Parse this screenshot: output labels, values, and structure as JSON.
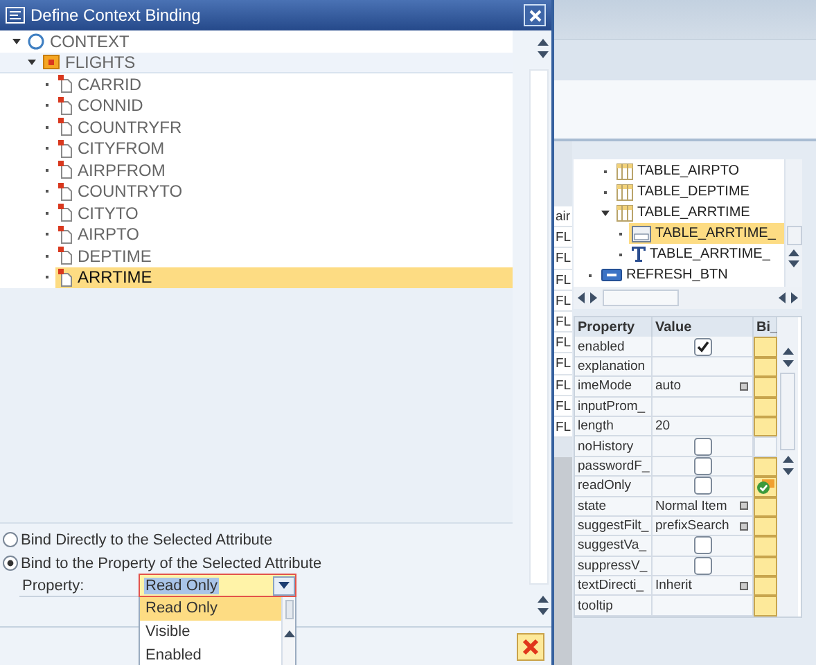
{
  "dialog": {
    "title": "Define Context Binding",
    "tree": [
      {
        "label": "CONTEXT",
        "kind": "context",
        "expanded": true,
        "selected": false,
        "children": [
          {
            "label": "FLIGHTS",
            "kind": "node",
            "expanded": true,
            "selected": false,
            "children": [
              {
                "label": "CARRID",
                "kind": "attribute",
                "selected": false
              },
              {
                "label": "CONNID",
                "kind": "attribute",
                "selected": false
              },
              {
                "label": "COUNTRYFR",
                "kind": "attribute",
                "selected": false
              },
              {
                "label": "CITYFROM",
                "kind": "attribute",
                "selected": false
              },
              {
                "label": "AIRPFROM",
                "kind": "attribute",
                "selected": false
              },
              {
                "label": "COUNTRYTO",
                "kind": "attribute",
                "selected": false
              },
              {
                "label": "CITYTO",
                "kind": "attribute",
                "selected": false
              },
              {
                "label": "AIRPTO",
                "kind": "attribute",
                "selected": false
              },
              {
                "label": "DEPTIME",
                "kind": "attribute",
                "selected": false
              },
              {
                "label": "ARRTIME",
                "kind": "attribute",
                "selected": true
              }
            ]
          }
        ]
      }
    ],
    "bind_options": [
      {
        "label": "Bind Directly to the Selected Attribute",
        "selected": false
      },
      {
        "label": "Bind to the Property of the Selected Attribute",
        "selected": true
      }
    ],
    "property": {
      "label": "Property:",
      "value": "Read Only",
      "options": [
        {
          "label": "Read Only",
          "selected": true
        },
        {
          "label": "Visible",
          "selected": false
        },
        {
          "label": "Enabled",
          "selected": false
        }
      ]
    }
  },
  "background": {
    "list_column": [
      "air",
      "FL",
      "FL",
      "FL",
      "FL",
      "FL",
      "FL",
      "FL",
      "FL",
      "FL",
      "FL"
    ],
    "ui_tree": [
      {
        "children": [
          {
            "label": "TABLE_AIRPTO",
            "kind": "table",
            "selected": false
          },
          {
            "label": "TABLE_DEPTIME",
            "kind": "table",
            "selected": false
          },
          {
            "label": "TABLE_ARRTIME",
            "kind": "table",
            "expanded": true,
            "selected": false,
            "children": [
              {
                "label": "TABLE_ARRTIME_",
                "kind": "input",
                "selected": true
              },
              {
                "label": "TABLE_ARRTIME_",
                "kind": "textview",
                "selected": false
              }
            ]
          }
        ]
      },
      {
        "label": "REFRESH_BTN",
        "kind": "button",
        "selected": false
      }
    ],
    "property_table": {
      "columns": [
        "Property",
        "Value",
        "Bi_"
      ],
      "rows": [
        {
          "name": "enabled",
          "kind": "check",
          "checked": true,
          "bindable": true,
          "bound": false
        },
        {
          "name": "explanation",
          "kind": "text",
          "bindable": true,
          "bound": false
        },
        {
          "name": "imeMode",
          "kind": "dropdown",
          "value": "auto",
          "bindable": true,
          "bound": false
        },
        {
          "name": "inputProm_",
          "kind": "text",
          "bindable": true,
          "bound": false
        },
        {
          "name": "length",
          "kind": "text",
          "value": "20",
          "bindable": true,
          "bound": false
        },
        {
          "name": "noHistory",
          "kind": "check",
          "checked": false,
          "bindable": false,
          "bound": false
        },
        {
          "name": "passwordF_",
          "kind": "check",
          "checked": false,
          "bindable": true,
          "bound": false
        },
        {
          "name": "readOnly",
          "kind": "check",
          "checked": false,
          "bindable": true,
          "bound": true
        },
        {
          "name": "state",
          "kind": "dropdown",
          "value": "Normal Item",
          "bindable": true,
          "bound": false
        },
        {
          "name": "suggestFilt_",
          "kind": "dropdown",
          "value": "prefixSearch",
          "bindable": true,
          "bound": false
        },
        {
          "name": "suggestVa_",
          "kind": "check",
          "checked": false,
          "bindable": true,
          "bound": false
        },
        {
          "name": "suppressV_",
          "kind": "check",
          "checked": false,
          "bindable": true,
          "bound": false
        },
        {
          "name": "textDirecti_",
          "kind": "dropdown",
          "value": "Inherit",
          "bindable": true,
          "bound": false
        },
        {
          "name": "tooltip",
          "kind": "text",
          "bindable": true,
          "bound": false
        }
      ]
    }
  }
}
